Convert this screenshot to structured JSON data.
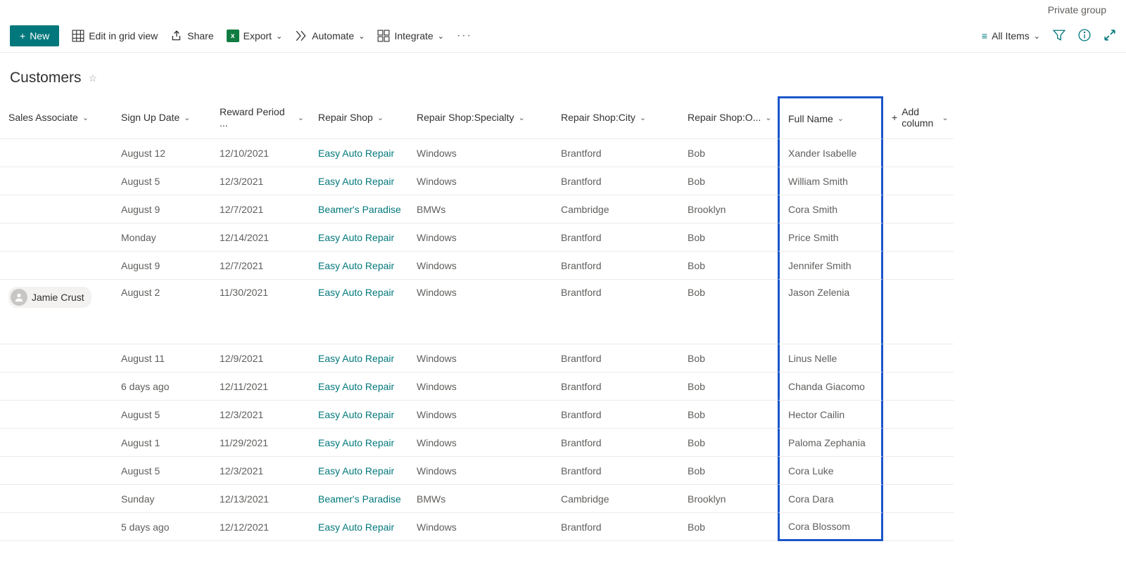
{
  "top_label": "Private group",
  "toolbar": {
    "new": "New",
    "edit_grid": "Edit in grid view",
    "share": "Share",
    "export": "Export",
    "automate": "Automate",
    "integrate": "Integrate",
    "view_name": "All Items"
  },
  "list_title": "Customers",
  "columns": {
    "sales_associate": "Sales Associate",
    "sign_up_date": "Sign Up Date",
    "reward_period": "Reward Period ...",
    "repair_shop": "Repair Shop",
    "specialty": "Repair Shop:Specialty",
    "city": "Repair Shop:City",
    "owner": "Repair Shop:O...",
    "full_name": "Full Name",
    "add_column": "Add column"
  },
  "rows": [
    {
      "associate": "",
      "sign_up": "August 12",
      "reward": "12/10/2021",
      "shop": "Easy Auto Repair",
      "specialty": "Windows",
      "city": "Brantford",
      "owner": "Bob",
      "full_name": "Xander Isabelle",
      "tall": false
    },
    {
      "associate": "",
      "sign_up": "August 5",
      "reward": "12/3/2021",
      "shop": "Easy Auto Repair",
      "specialty": "Windows",
      "city": "Brantford",
      "owner": "Bob",
      "full_name": "William Smith",
      "tall": false
    },
    {
      "associate": "",
      "sign_up": "August 9",
      "reward": "12/7/2021",
      "shop": "Beamer's Paradise",
      "specialty": "BMWs",
      "city": "Cambridge",
      "owner": "Brooklyn",
      "full_name": "Cora Smith",
      "tall": false
    },
    {
      "associate": "",
      "sign_up": "Monday",
      "reward": "12/14/2021",
      "shop": "Easy Auto Repair",
      "specialty": "Windows",
      "city": "Brantford",
      "owner": "Bob",
      "full_name": "Price Smith",
      "tall": false
    },
    {
      "associate": "",
      "sign_up": "August 9",
      "reward": "12/7/2021",
      "shop": "Easy Auto Repair",
      "specialty": "Windows",
      "city": "Brantford",
      "owner": "Bob",
      "full_name": "Jennifer Smith",
      "tall": false
    },
    {
      "associate": "Jamie Crust",
      "sign_up": "August 2",
      "reward": "11/30/2021",
      "shop": "Easy Auto Repair",
      "specialty": "Windows",
      "city": "Brantford",
      "owner": "Bob",
      "full_name": "Jason Zelenia",
      "tall": true
    },
    {
      "associate": "",
      "sign_up": "August 11",
      "reward": "12/9/2021",
      "shop": "Easy Auto Repair",
      "specialty": "Windows",
      "city": "Brantford",
      "owner": "Bob",
      "full_name": "Linus Nelle",
      "tall": false
    },
    {
      "associate": "",
      "sign_up": "6 days ago",
      "reward": "12/11/2021",
      "shop": "Easy Auto Repair",
      "specialty": "Windows",
      "city": "Brantford",
      "owner": "Bob",
      "full_name": "Chanda Giacomo",
      "tall": false
    },
    {
      "associate": "",
      "sign_up": "August 5",
      "reward": "12/3/2021",
      "shop": "Easy Auto Repair",
      "specialty": "Windows",
      "city": "Brantford",
      "owner": "Bob",
      "full_name": "Hector Cailin",
      "tall": false
    },
    {
      "associate": "",
      "sign_up": "August 1",
      "reward": "11/29/2021",
      "shop": "Easy Auto Repair",
      "specialty": "Windows",
      "city": "Brantford",
      "owner": "Bob",
      "full_name": "Paloma Zephania",
      "tall": false
    },
    {
      "associate": "",
      "sign_up": "August 5",
      "reward": "12/3/2021",
      "shop": "Easy Auto Repair",
      "specialty": "Windows",
      "city": "Brantford",
      "owner": "Bob",
      "full_name": "Cora Luke",
      "tall": false
    },
    {
      "associate": "",
      "sign_up": "Sunday",
      "reward": "12/13/2021",
      "shop": "Beamer's Paradise",
      "specialty": "BMWs",
      "city": "Cambridge",
      "owner": "Brooklyn",
      "full_name": "Cora Dara",
      "tall": false
    },
    {
      "associate": "",
      "sign_up": "5 days ago",
      "reward": "12/12/2021",
      "shop": "Easy Auto Repair",
      "specialty": "Windows",
      "city": "Brantford",
      "owner": "Bob",
      "full_name": "Cora Blossom",
      "tall": false
    }
  ]
}
